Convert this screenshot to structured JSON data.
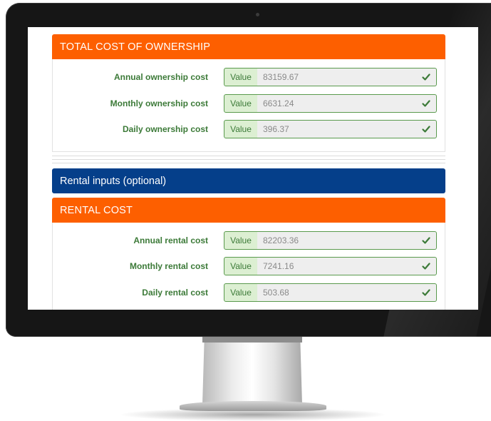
{
  "ownership": {
    "header": "TOTAL COST OF OWNERSHIP",
    "rows": [
      {
        "label": "Annual ownership cost",
        "addon": "Value",
        "value": "83159.67"
      },
      {
        "label": "Monthly ownership cost",
        "addon": "Value",
        "value": "6631.24"
      },
      {
        "label": "Daily ownership cost",
        "addon": "Value",
        "value": "396.37"
      }
    ]
  },
  "rental_inputs": {
    "header": "Rental inputs (optional)"
  },
  "rental": {
    "header": "RENTAL COST",
    "rows": [
      {
        "label": "Annual rental cost",
        "addon": "Value",
        "value": "82203.36"
      },
      {
        "label": "Monthly rental cost",
        "addon": "Value",
        "value": "7241.16"
      },
      {
        "label": "Daily rental cost",
        "addon": "Value",
        "value": "503.68"
      }
    ]
  },
  "colors": {
    "orange_header": "#fd5f00",
    "blue_header": "#053f8a",
    "valid_green": "#3c7a38",
    "addon_bg": "#dcefd2"
  },
  "icons": {
    "valid": "check-icon"
  }
}
